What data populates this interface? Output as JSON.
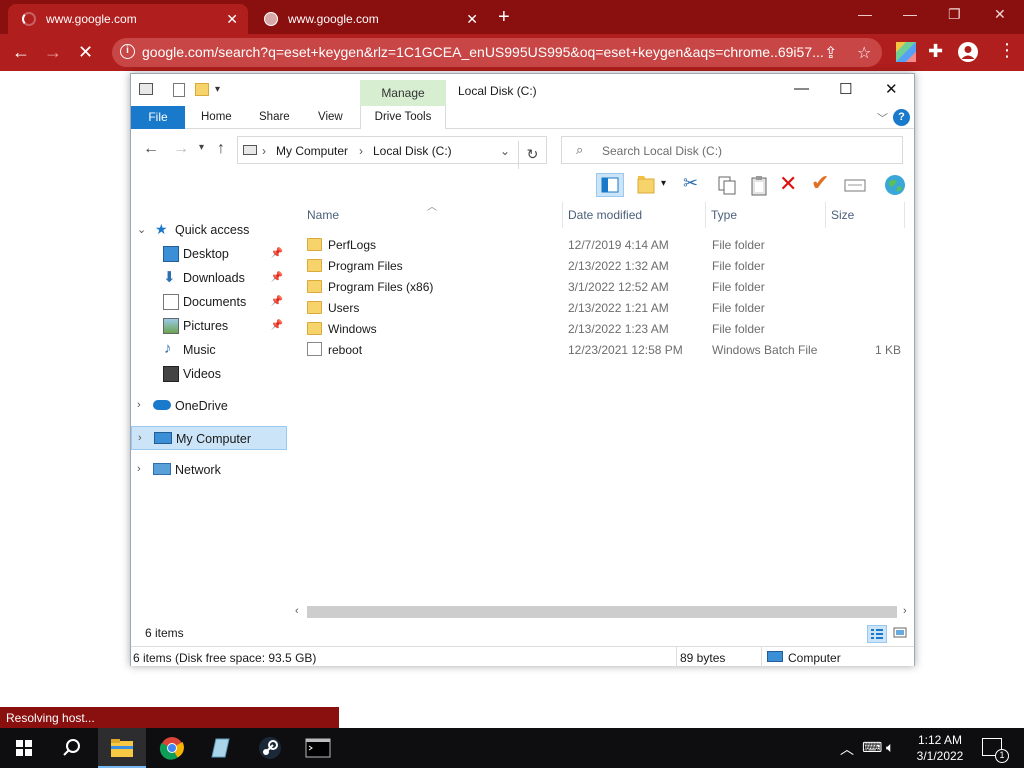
{
  "browser": {
    "tabs": [
      {
        "title": "www.google.com",
        "loading": true
      },
      {
        "title": "www.google.com",
        "loading": false
      }
    ],
    "url": "google.com/search?q=eset+keygen&rlz=1C1GCEA_enUS995US995&oq=eset+keygen&aqs=chrome..69i57...",
    "status_text": "Resolving host..."
  },
  "explorer": {
    "title": "Local Disk (C:)",
    "contextual_group": "Manage",
    "ribbon_tabs": {
      "file": "File",
      "home": "Home",
      "share": "Share",
      "view": "View",
      "drive_tools": "Drive Tools"
    },
    "breadcrumb": [
      "My Computer",
      "Local Disk (C:)"
    ],
    "search_placeholder": "Search Local Disk (C:)",
    "nav": {
      "quick_access": "Quick access",
      "items": [
        {
          "label": "Desktop",
          "pinned": true
        },
        {
          "label": "Downloads",
          "pinned": true
        },
        {
          "label": "Documents",
          "pinned": true
        },
        {
          "label": "Pictures",
          "pinned": true
        },
        {
          "label": "Music",
          "pinned": false
        },
        {
          "label": "Videos",
          "pinned": false
        }
      ],
      "onedrive": "OneDrive",
      "my_computer": "My Computer",
      "network": "Network"
    },
    "columns": {
      "name": "Name",
      "date": "Date modified",
      "type": "Type",
      "size": "Size"
    },
    "files": [
      {
        "name": "PerfLogs",
        "date": "12/7/2019 4:14 AM",
        "type": "File folder",
        "size": "",
        "kind": "folder"
      },
      {
        "name": "Program Files",
        "date": "2/13/2022 1:32 AM",
        "type": "File folder",
        "size": "",
        "kind": "folder"
      },
      {
        "name": "Program Files (x86)",
        "date": "3/1/2022 12:52 AM",
        "type": "File folder",
        "size": "",
        "kind": "folder"
      },
      {
        "name": "Users",
        "date": "2/13/2022 1:21 AM",
        "type": "File folder",
        "size": "",
        "kind": "folder"
      },
      {
        "name": "Windows",
        "date": "2/13/2022 1:23 AM",
        "type": "File folder",
        "size": "",
        "kind": "folder"
      },
      {
        "name": "reboot",
        "date": "12/23/2021 12:58 PM",
        "type": "Windows Batch File",
        "size": "1 KB",
        "kind": "batch"
      }
    ],
    "item_count": "6 items",
    "status": {
      "details": "6 items (Disk free space: 93.5 GB)",
      "size": "89 bytes",
      "location": "Computer"
    }
  },
  "taskbar": {
    "time": "1:12 AM",
    "date": "3/1/2022",
    "notification_count": "1"
  },
  "colors": {
    "chrome_frame": "#8a0f0f",
    "chrome_toolbar": "#b01e1e",
    "explorer_accent": "#1979ca",
    "manage_tab": "#d7efd0"
  }
}
